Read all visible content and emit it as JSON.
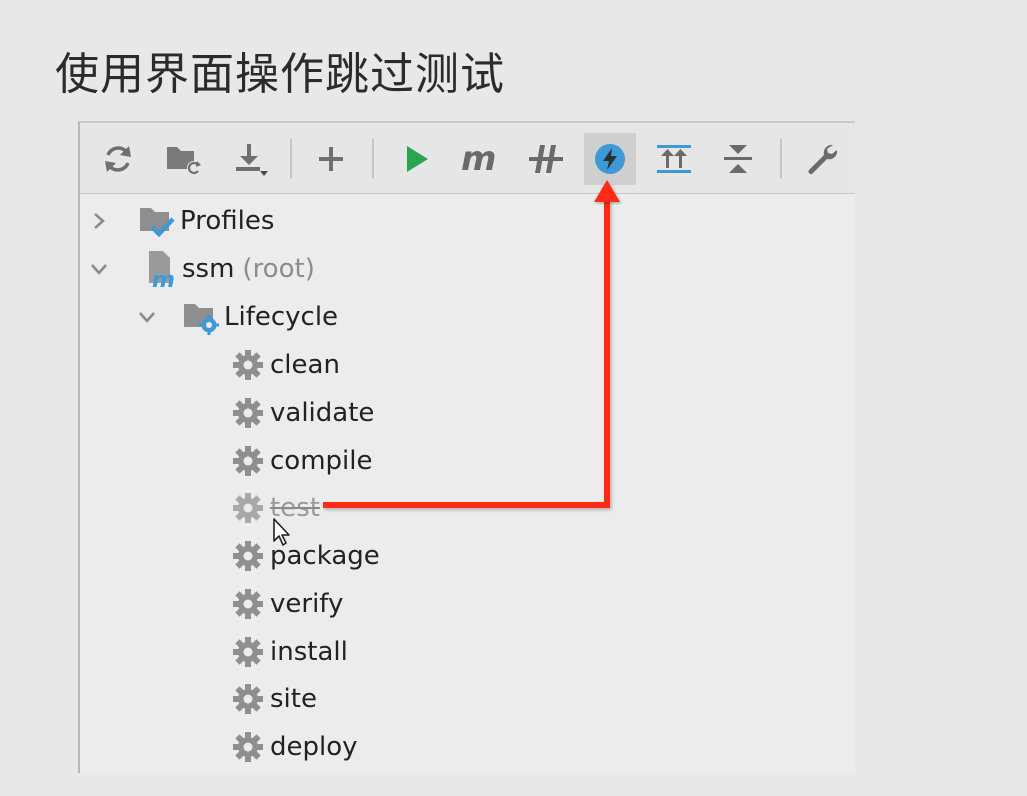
{
  "slide": {
    "title": "使用界面操作跳过测试"
  },
  "toolbar": {
    "buttons": [
      {
        "icon": "reload-icon"
      },
      {
        "icon": "folder-sync-icon"
      },
      {
        "icon": "download-icon"
      },
      {
        "icon": "add-icon"
      },
      {
        "icon": "run-icon"
      },
      {
        "icon": "maven-icon"
      },
      {
        "icon": "toggle-offline-icon"
      },
      {
        "icon": "skip-tests-icon",
        "active": true
      },
      {
        "icon": "expand-all-icon"
      },
      {
        "icon": "collapse-all-icon"
      },
      {
        "icon": "settings-wrench-icon"
      }
    ]
  },
  "tree": {
    "profiles": {
      "label": "Profiles"
    },
    "project": {
      "name": "ssm",
      "suffix": "(root)"
    },
    "lifecycle": {
      "label": "Lifecycle",
      "phases": [
        {
          "label": "clean",
          "skipped": false
        },
        {
          "label": "validate",
          "skipped": false
        },
        {
          "label": "compile",
          "skipped": false
        },
        {
          "label": "test",
          "skipped": true
        },
        {
          "label": "package",
          "skipped": false
        },
        {
          "label": "verify",
          "skipped": false
        },
        {
          "label": "install",
          "skipped": false
        },
        {
          "label": "site",
          "skipped": false
        },
        {
          "label": "deploy",
          "skipped": false
        }
      ]
    }
  },
  "colors": {
    "arrow": "#ff2a12",
    "accent": "#3d9ad6",
    "run": "#2aa44f",
    "icon_gray": "#8f8f8f"
  }
}
